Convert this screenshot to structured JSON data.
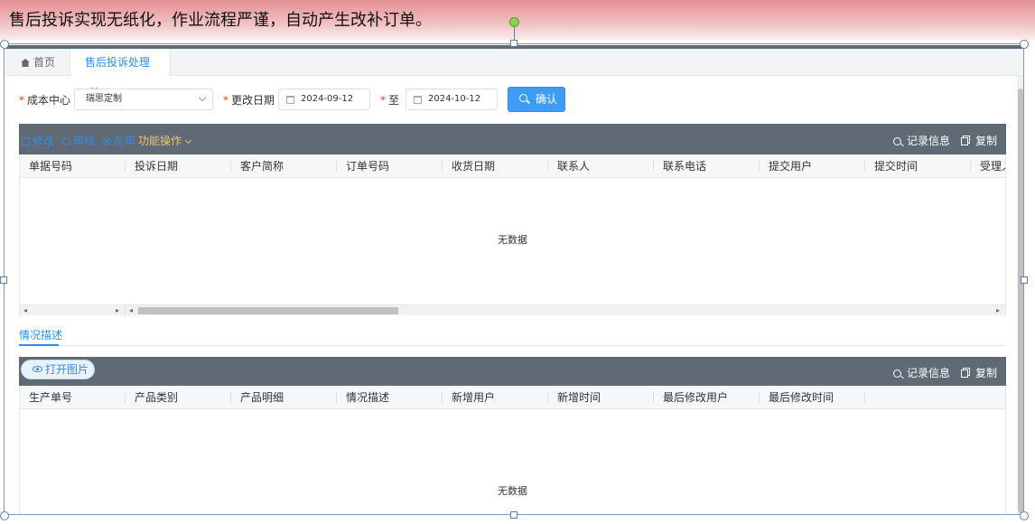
{
  "caption": "售后投诉实现无纸化，作业流程严谨，自动产生改补订单。",
  "tabs": {
    "home": "首页",
    "active": "售后投诉处理",
    "close": "×"
  },
  "filters": {
    "cost_center_label": "成本中心",
    "cost_center_value": "瑞思定制",
    "date_label": "更改日期",
    "date_from": "2024-09-12",
    "to_label": "至",
    "date_to": "2024-10-12",
    "confirm": "确认",
    "required_mark": "*"
  },
  "toolbar1": {
    "edit": "修改",
    "audit": "审核",
    "reverse_audit": "反审",
    "functions": "功能操作",
    "record_info": "记录信息",
    "copy": "复制"
  },
  "table1": {
    "columns": [
      "单据号码",
      "投诉日期",
      "客户简称",
      "订单号码",
      "收货日期",
      "联系人",
      "联系电话",
      "提交用户",
      "提交时间",
      "受理人"
    ],
    "empty": "无数据"
  },
  "subtab": "情况描述",
  "toolbar2": {
    "open_image": "打开图片",
    "record_info": "记录信息",
    "copy": "复制"
  },
  "table2": {
    "columns": [
      "生产单号",
      "产品类别",
      "产品明细",
      "情况描述",
      "新增用户",
      "新增时间",
      "最后修改用户",
      "最后修改时间"
    ],
    "empty": "无数据"
  },
  "colors": {
    "accent": "#2d8cf0",
    "toolbar": "#5f6a75",
    "gold": "#f0c36a",
    "required": "#ed4014"
  }
}
